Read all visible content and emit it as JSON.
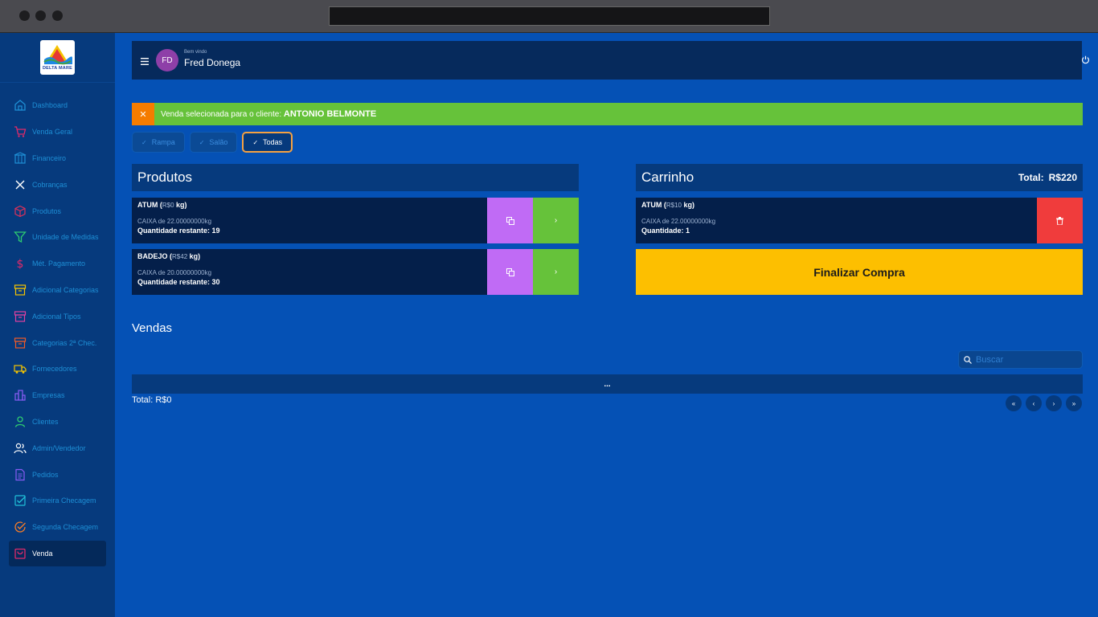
{
  "browser": {},
  "brand": {
    "logo_text": "DELTA MARE"
  },
  "sidebar": {
    "items": [
      {
        "label": "Dashboard",
        "icon": "home-icon",
        "color": "#1e8fd6"
      },
      {
        "label": "Venda Geral",
        "icon": "cart-icon",
        "color": "#e02a6a"
      },
      {
        "label": "Financeiro",
        "icon": "building-icon",
        "color": "#1e8fd6"
      },
      {
        "label": "Cobranças",
        "icon": "close-icon",
        "color": "#ffffff"
      },
      {
        "label": "Produtos",
        "icon": "box-icon",
        "color": "#e0305a"
      },
      {
        "label": "Unidade de Medidas",
        "icon": "filter-icon",
        "color": "#2ecc71"
      },
      {
        "label": "Mét. Pagamento",
        "icon": "dollar-icon",
        "color": "#e02a6a"
      },
      {
        "label": "Adicional Categorias",
        "icon": "archive-icon",
        "color": "#f5c400"
      },
      {
        "label": "Adicional Tipos",
        "icon": "archive-icon",
        "color": "#e040a0"
      },
      {
        "label": "Categorias 2ª Chec.",
        "icon": "archive-icon",
        "color": "#f05a28"
      },
      {
        "label": "Fornecedores",
        "icon": "truck-icon",
        "color": "#f5c400"
      },
      {
        "label": "Empresas",
        "icon": "buildings-icon",
        "color": "#8a5cf5"
      },
      {
        "label": "Clientes",
        "icon": "user-icon",
        "color": "#2ecc71"
      },
      {
        "label": "Admin/Vendedor",
        "icon": "users-icon",
        "color": "#ffffff"
      },
      {
        "label": "Pedidos",
        "icon": "document-icon",
        "color": "#8a5cf5"
      },
      {
        "label": "Primeira Checagem",
        "icon": "checkbox-icon",
        "color": "#20c0d8"
      },
      {
        "label": "Segunda Checagem",
        "icon": "check-circle-icon",
        "color": "#f57c28"
      },
      {
        "label": "Venda",
        "icon": "bag-icon",
        "color": "#e02a6a",
        "active": true
      }
    ]
  },
  "header": {
    "avatar_initials": "FD",
    "welcome": "Bem vindo",
    "user_name": "Fred Donega"
  },
  "alert": {
    "close": "✕",
    "text": "Venda selecionada para o cliente:",
    "client": "ANTONIO BELMONTE"
  },
  "filters": [
    {
      "label": "Rampa",
      "active": false
    },
    {
      "label": "Salão",
      "active": false
    },
    {
      "label": "Todas",
      "active": true
    }
  ],
  "produtos": {
    "title": "Produtos",
    "items": [
      {
        "name": "ATUM",
        "open": "(",
        "price": "R$0",
        "unit": "kg)",
        "desc": "CAIXA de 22.00000000kg",
        "qty": "Quantidade restante: 19"
      },
      {
        "name": "BADEJO",
        "open": "(",
        "price": "R$42",
        "unit": "kg)",
        "desc": "CAIXA de 20.00000000kg",
        "qty": "Quantidade restante: 30"
      }
    ]
  },
  "carrinho": {
    "title": "Carrinho",
    "total_label": "Total:",
    "total_value": "R$220",
    "items": [
      {
        "name": "ATUM",
        "open": "(",
        "price": "R$10",
        "unit": "kg)",
        "desc": "CAIXA de 22.00000000kg",
        "qty": "Quantidade: 1"
      }
    ],
    "finalize_label": "Finalizar Compra"
  },
  "vendas": {
    "title": "Vendas",
    "search_placeholder": "Buscar",
    "table_placeholder": "...",
    "total": "Total: R$0",
    "pager": [
      "«",
      "‹",
      "›",
      "»"
    ]
  },
  "colors": {
    "background": "#0551b5",
    "sidebar": "#063a7d",
    "alert_green": "#66c23a",
    "alert_close": "#f57c00",
    "copy_button": "#c06bf5",
    "go_button": "#66c23a",
    "delete_button": "#f03c3c",
    "finalize_button": "#fdbf00"
  }
}
